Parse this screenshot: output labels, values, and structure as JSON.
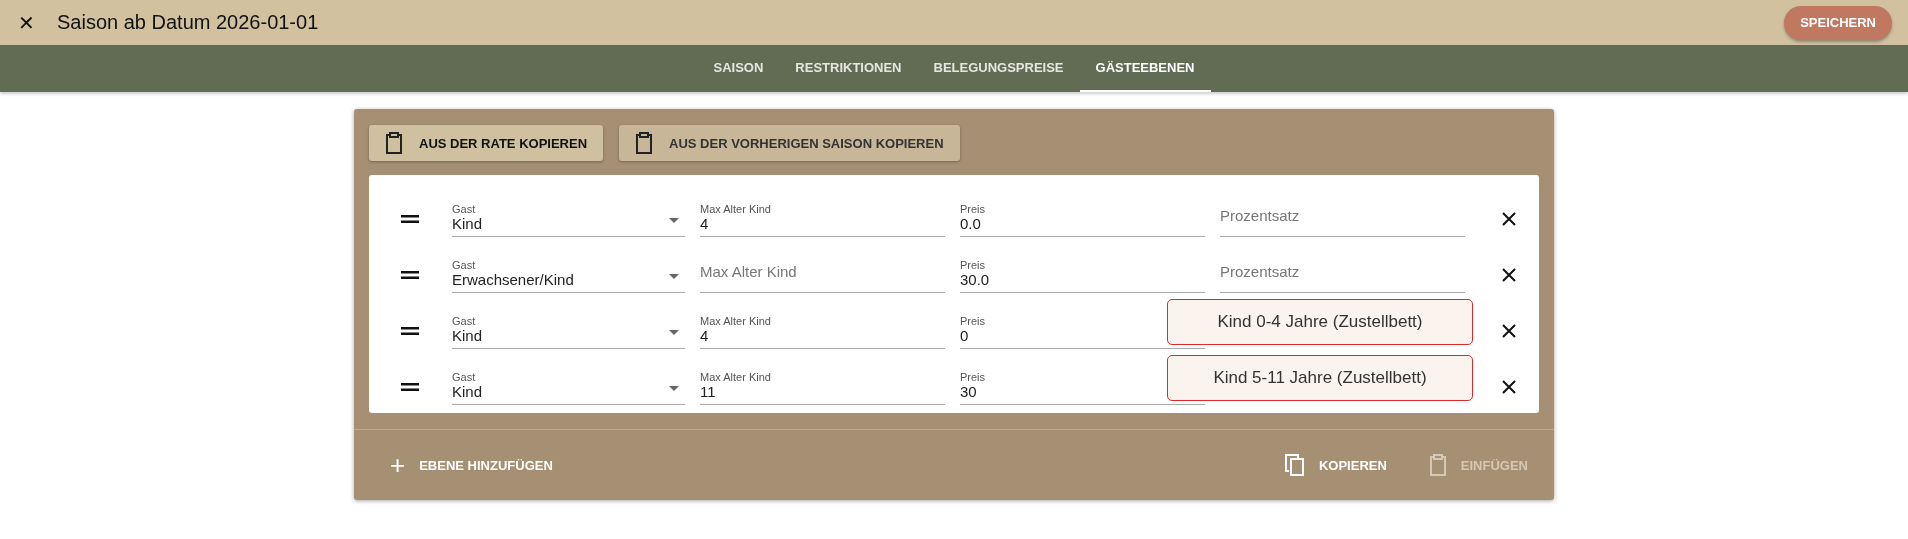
{
  "header": {
    "close_icon": "✕",
    "title": "Saison ab Datum 2026-01-01",
    "save_button": "SPEICHERN"
  },
  "tabs": [
    {
      "label": "SAISON",
      "selected": false
    },
    {
      "label": "RESTRIKTIONEN",
      "selected": false
    },
    {
      "label": "BELEGUNGSPREISE",
      "selected": false
    },
    {
      "label": "GÄSTEEBENEN",
      "selected": true
    }
  ],
  "copy_buttons": [
    {
      "label": "AUS DER RATE KOPIEREN",
      "selected": true
    },
    {
      "label": "AUS DER VORHERIGEN SAISON KOPIEREN",
      "selected": false
    }
  ],
  "rows": [
    {
      "gast": {
        "label": "Gast",
        "value": "Kind"
      },
      "max_alter": {
        "label": "Max Alter Kind",
        "value": "4"
      },
      "preis": {
        "label": "Preis",
        "value": "0.0"
      },
      "prozentsatz": {
        "label": "Prozentsatz"
      }
    },
    {
      "gast": {
        "label": "Gast",
        "value": "Erwachsener/Kind"
      },
      "max_alter": {
        "label": "Max Alter Kind"
      },
      "preis": {
        "label": "Preis",
        "value": "30.0"
      },
      "prozentsatz": {
        "label": "Prozentsatz"
      }
    },
    {
      "gast": {
        "label": "Gast",
        "value": "Kind"
      },
      "max_alter": {
        "label": "Max Alter Kind",
        "value": "4"
      },
      "preis": {
        "label": "Preis",
        "value": "0"
      },
      "note": "Kind 0-4 Jahre (Zustellbett)"
    },
    {
      "gast": {
        "label": "Gast",
        "value": "Kind"
      },
      "max_alter": {
        "label": "Max Alter Kind",
        "value": "11"
      },
      "preis": {
        "label": "Preis",
        "value": "30"
      },
      "note": "Kind 5-11 Jahre (Zustellbett)"
    }
  ],
  "footer": {
    "add_button": {
      "icon": "+",
      "label": "EBENE HINZUFÜGEN"
    },
    "actions": [
      {
        "label": "KOPIEREN",
        "disabled": false
      },
      {
        "label": "EINFÜGEN",
        "disabled": true
      }
    ]
  }
}
